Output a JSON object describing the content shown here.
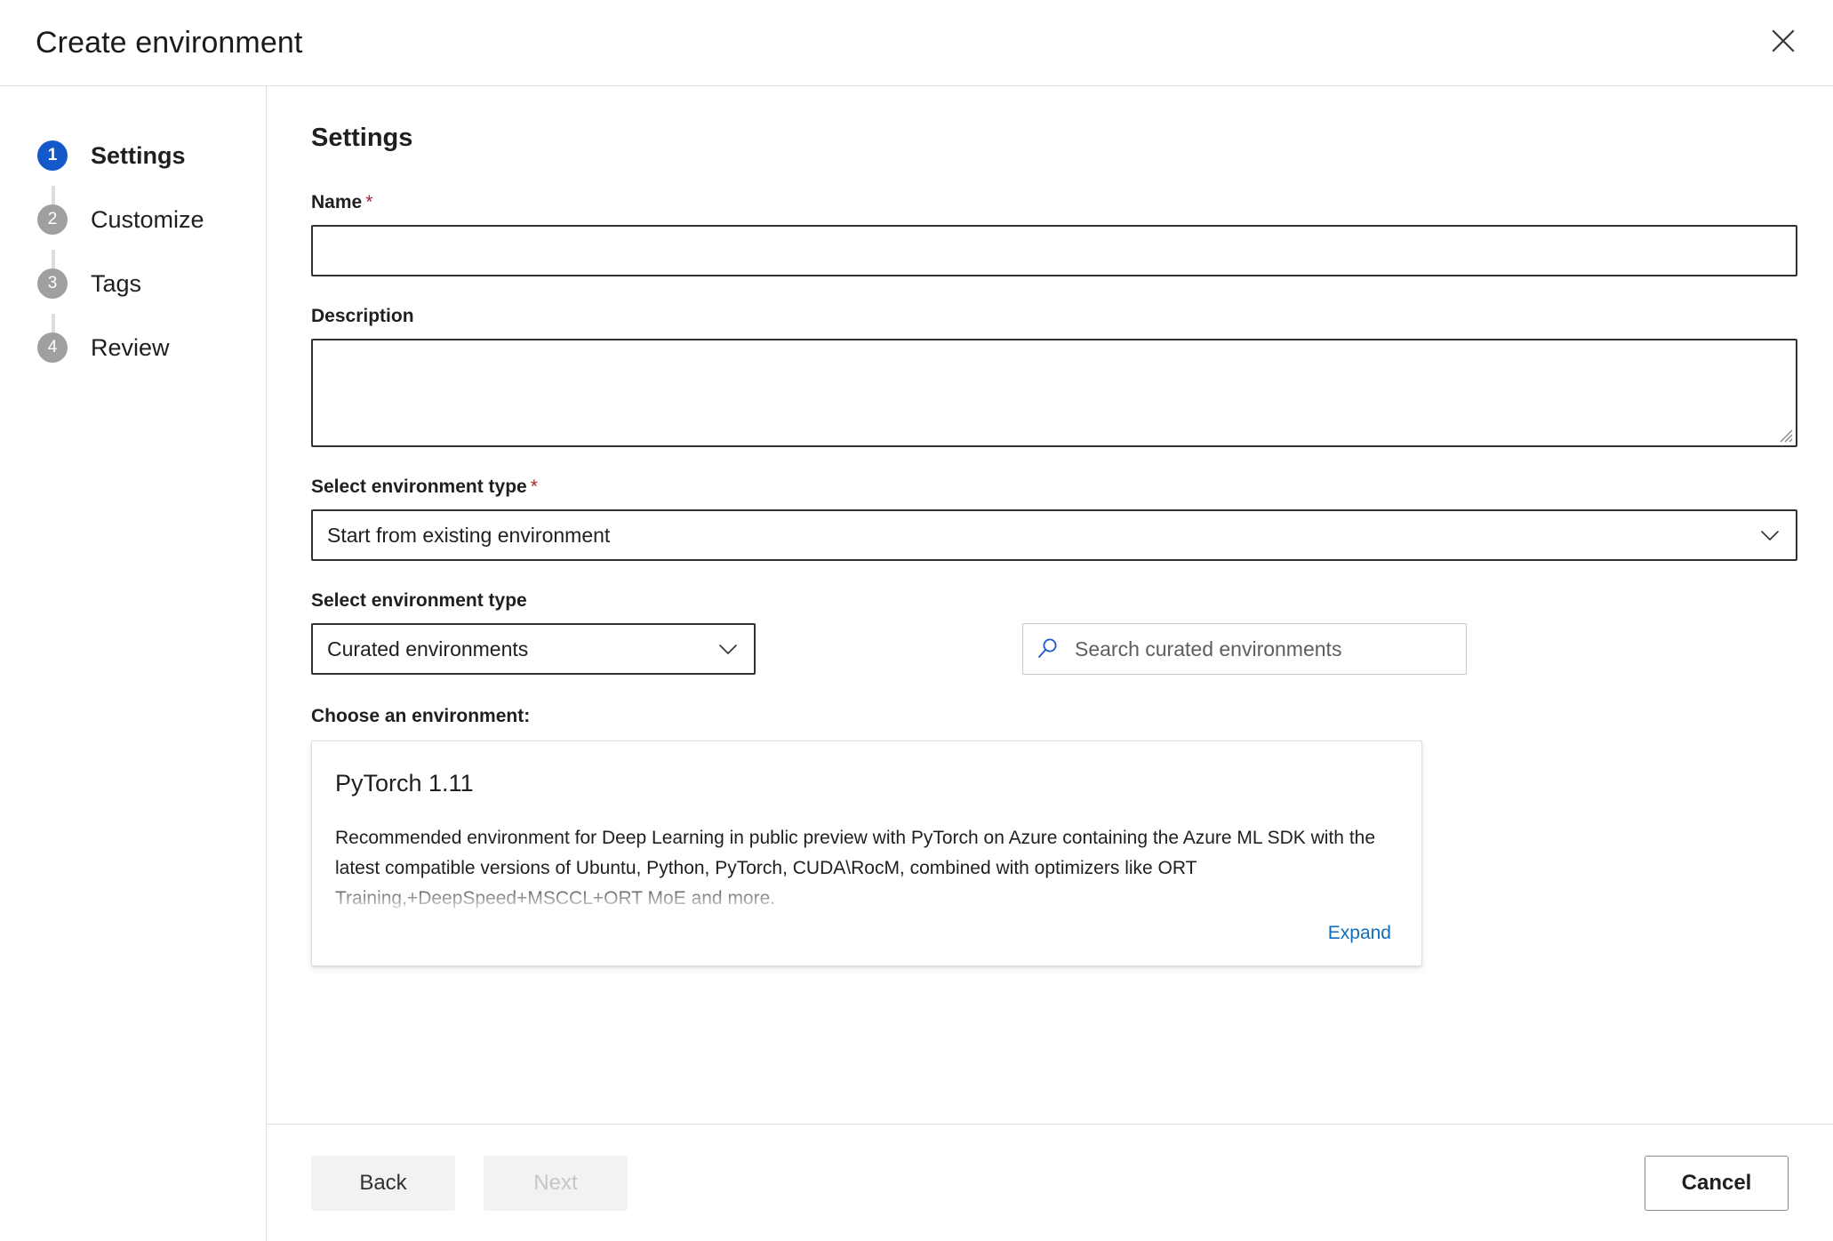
{
  "header": {
    "title": "Create environment",
    "close_label": "Close"
  },
  "wizard": {
    "steps": [
      {
        "number": "1",
        "label": "Settings"
      },
      {
        "number": "2",
        "label": "Customize"
      },
      {
        "number": "3",
        "label": "Tags"
      },
      {
        "number": "4",
        "label": "Review"
      }
    ]
  },
  "content": {
    "heading": "Settings",
    "name": {
      "label": "Name",
      "required_marker": "*",
      "value": "",
      "placeholder": ""
    },
    "description": {
      "label": "Description",
      "value": "",
      "placeholder": ""
    },
    "environment_type": {
      "label": "Select environment type",
      "required_marker": "*",
      "value": "Start from existing environment"
    },
    "environment_source": {
      "label": "Select environment type",
      "value": "Curated environments"
    },
    "search": {
      "placeholder": "Search curated environments",
      "value": ""
    },
    "choose_label": "Choose an environment:",
    "environment_card": {
      "title": "PyTorch 1.11",
      "description": "Recommended environment for Deep Learning in public preview with PyTorch on Azure containing the Azure ML SDK with the latest compatible versions of Ubuntu, Python, PyTorch, CUDA\\RocM, combined with optimizers like ORT Training,+DeepSpeed+MSCCL+ORT MoE and more.",
      "expand_label": "Expand"
    }
  },
  "footer": {
    "back_label": "Back",
    "next_label": "Next",
    "cancel_label": "Cancel"
  },
  "colors": {
    "active_step": "#1558c8",
    "inactive_step": "#a19f9d",
    "required": "#a4262c",
    "link": "#0f6cbd",
    "search_icon": "#1558c8",
    "border_strong": "#323130",
    "border_light": "#e1dfdd"
  }
}
